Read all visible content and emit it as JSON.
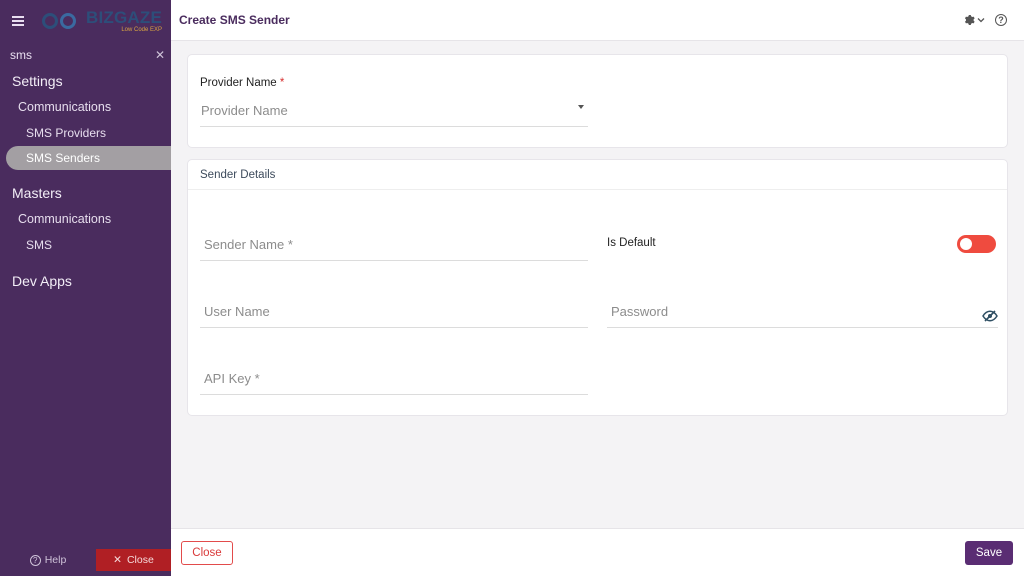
{
  "sidebar": {
    "logo": {
      "word": "BIZGAZE",
      "tagline": "Low Code EXP"
    },
    "search_value": "sms",
    "sections": [
      {
        "heading": "Settings",
        "group": "Communications",
        "items": [
          "SMS Providers",
          "SMS Senders"
        ]
      },
      {
        "heading": "Masters",
        "group": "Communications",
        "items": [
          "SMS"
        ]
      },
      {
        "heading": "Dev Apps"
      }
    ],
    "active_item": "SMS Senders",
    "help_label": "Help",
    "close_label": "Close"
  },
  "header": {
    "title": "Create SMS Sender",
    "icons": [
      "gear-icon",
      "chevron-down-icon",
      "help-icon"
    ]
  },
  "provider_card": {
    "label": "Provider Name",
    "required_mark": "*",
    "placeholder": "Provider Name"
  },
  "sender_card": {
    "title": "Sender Details",
    "sender_name_placeholder": "Sender Name *",
    "is_default_label": "Is Default",
    "is_default_on": false,
    "user_name_placeholder": "User Name",
    "password_placeholder": "Password",
    "api_key_placeholder": "API Key *"
  },
  "footer": {
    "close_label": "Close",
    "save_label": "Save"
  },
  "colors": {
    "sidebar_bg": "#4a2c5e",
    "accent": "#5a2d73",
    "toggle": "#ef4b3f",
    "danger": "#d93a3a"
  }
}
